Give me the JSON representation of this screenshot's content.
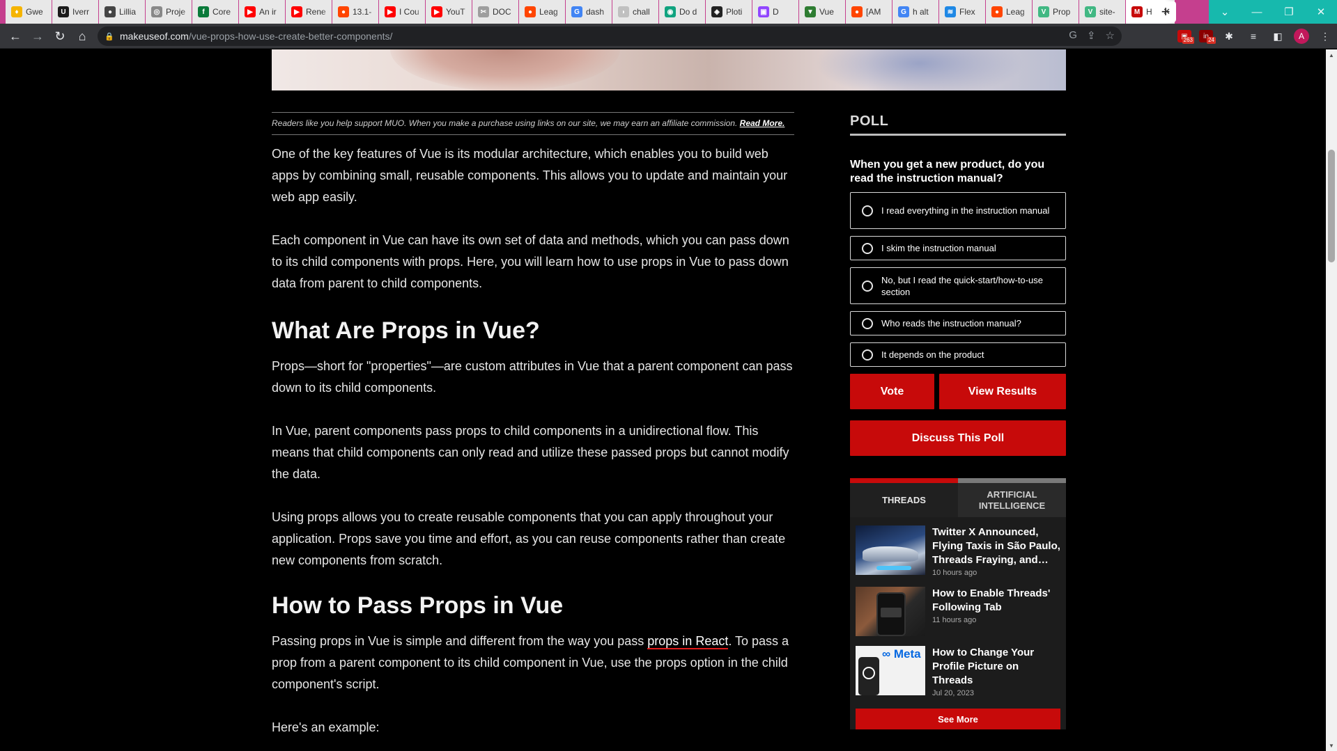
{
  "browser": {
    "tabs": [
      {
        "label": "Gwe",
        "fav_color": "#f5b400",
        "fav_glyph": "♦"
      },
      {
        "label": "Iverr",
        "fav_color": "#1b1b1b",
        "fav_glyph": "U"
      },
      {
        "label": "Lillia",
        "fav_color": "#444444",
        "fav_glyph": "●"
      },
      {
        "label": "Proje",
        "fav_color": "#888888",
        "fav_glyph": "◎"
      },
      {
        "label": "Core",
        "fav_color": "#0a7a3a",
        "fav_glyph": "f"
      },
      {
        "label": "An ir",
        "fav_color": "#ff0000",
        "fav_glyph": "▶"
      },
      {
        "label": "Rene",
        "fav_color": "#ff0000",
        "fav_glyph": "▶"
      },
      {
        "label": "13.1-",
        "fav_color": "#ff4500",
        "fav_glyph": "●"
      },
      {
        "label": "I Cou",
        "fav_color": "#ff0000",
        "fav_glyph": "▶"
      },
      {
        "label": "YouT",
        "fav_color": "#ff0000",
        "fav_glyph": "▶"
      },
      {
        "label": "DOC",
        "fav_color": "#9e9e9e",
        "fav_glyph": "✂"
      },
      {
        "label": "Leag",
        "fav_color": "#ff4500",
        "fav_glyph": "●"
      },
      {
        "label": "dash",
        "fav_color": "#4285f4",
        "fav_glyph": "G"
      },
      {
        "label": "chall",
        "fav_color": "#c0c0c0",
        "fav_glyph": "◗"
      },
      {
        "label": "Do d",
        "fav_color": "#10a37f",
        "fav_glyph": "◉"
      },
      {
        "label": "Ploti",
        "fav_color": "#222222",
        "fav_glyph": "◈"
      },
      {
        "label": "D",
        "fav_color": "#9146ff",
        "fav_glyph": "▣"
      },
      {
        "label": "Vue",
        "fav_color": "#2e7d32",
        "fav_glyph": "▼"
      },
      {
        "label": "[AM",
        "fav_color": "#ff4500",
        "fav_glyph": "●"
      },
      {
        "label": "h alt",
        "fav_color": "#4285f4",
        "fav_glyph": "G"
      },
      {
        "label": "Flex",
        "fav_color": "#1e88e5",
        "fav_glyph": "≋"
      },
      {
        "label": "Leag",
        "fav_color": "#ff4500",
        "fav_glyph": "●"
      },
      {
        "label": "Prop",
        "fav_color": "#41b883",
        "fav_glyph": "V"
      },
      {
        "label": "site-",
        "fav_color": "#41b883",
        "fav_glyph": "V"
      },
      {
        "label": "H",
        "fav_color": "#c70a0a",
        "fav_glyph": "M",
        "active": true
      }
    ],
    "url_domain": "makeuseof.com",
    "url_path": "/vue-props-how-use-create-better-components/",
    "ext_badge_1": "263",
    "ext_badge_2": "24",
    "profile_initial": "A"
  },
  "article": {
    "disclosure": "Readers like you help support MUO. When you make a purchase using links on our site, we may earn an affiliate commission.",
    "disclosure_link": "Read More.",
    "p1": "One of the key features of Vue is its modular architecture, which enables you to build web apps by combining small, reusable components. This allows you to update and maintain your web app easily.",
    "p2": "Each component in Vue can have its own set of data and methods, which you can pass down to its child components with props. Here, you will learn how to use props in Vue to pass down data from parent to child components.",
    "h2_1": "What Are Props in Vue?",
    "p3": "Props—short for \"properties\"—are custom attributes in Vue that a parent component can pass down to its child components.",
    "p4": "In Vue, parent components pass props to child components in a unidirectional flow. This means that child components can only read and utilize these passed props but cannot modify the data.",
    "p5": "Using props allows you to create reusable components that you can apply throughout your application. Props save you time and effort, as you can reuse components rather than create new components from scratch.",
    "h2_2": "How to Pass Props in Vue",
    "p6_before": "Passing props in Vue is simple and different from the way you pass ",
    "p6_link": "props in React",
    "p6_after": ". To pass a prop from a parent component to its child component in Vue, use the props option in the child component's script.",
    "p7": "Here's an example:"
  },
  "poll": {
    "title": "POLL",
    "question": "When you get a new product, do you read the instruction manual?",
    "options": [
      "I read everything in the instruction manual",
      "I skim the instruction manual",
      "No, but I read the quick-start/how-to-use section",
      "Who reads the instruction manual?",
      "It depends on the product"
    ],
    "vote": "Vote",
    "view_results": "View Results",
    "discuss": "Discuss This Poll"
  },
  "threads": {
    "tab_active": "THREADS",
    "tab_inactive": "ARTIFICIAL INTELLIGENCE",
    "items": [
      {
        "title": "Twitter X Announced, Flying Taxis in São Paulo, Threads Fraying, and…",
        "time": "10 hours ago"
      },
      {
        "title": "How to Enable Threads' Following Tab",
        "time": "11 hours ago"
      },
      {
        "title": "How to Change Your Profile Picture on Threads",
        "time": "Jul 20, 2023"
      }
    ],
    "thumb3_text": "∞ Meta",
    "see_more": "See More"
  },
  "colors": {
    "accent_red": "#c70a0a",
    "tabstrip": "#c53f8e",
    "window_controls": "#17b9ad"
  }
}
